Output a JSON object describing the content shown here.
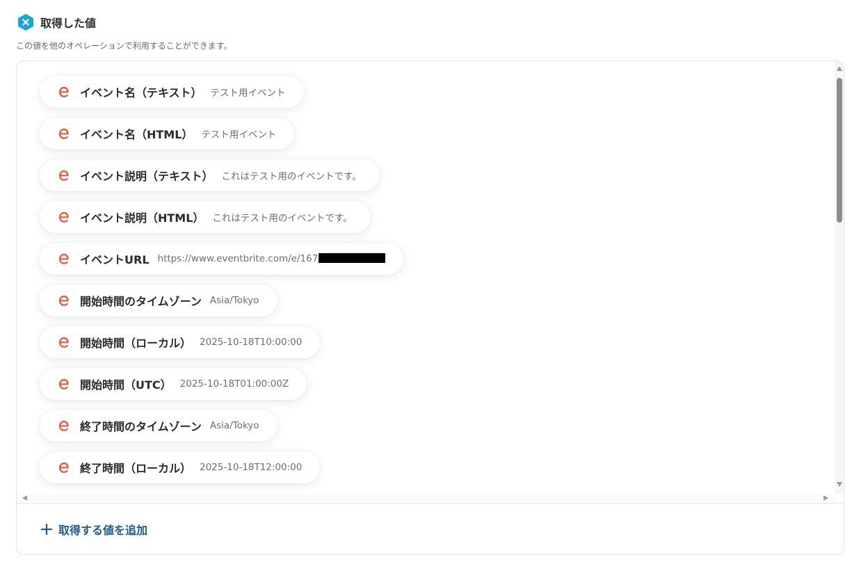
{
  "header": {
    "title": "取得した値",
    "subtitle": "この値を他のオペレーションで利用することができます。",
    "icon": "close-hex-icon"
  },
  "colors": {
    "accent": "#1aa7d8",
    "eventbrite": "#f05537",
    "link": "#1e5a8a"
  },
  "items": [
    {
      "label": "イベント名（テキスト）",
      "value": "テスト用イベント"
    },
    {
      "label": "イベント名（HTML）",
      "value": "テスト用イベント"
    },
    {
      "label": "イベント説明（テキスト）",
      "value": "これはテスト用のイベントです。"
    },
    {
      "label": "イベント説明（HTML）",
      "value": "これはテスト用のイベントです。"
    },
    {
      "label": "イベントURL",
      "value": "https://www.eventbrite.com/e/167",
      "redacted": true
    },
    {
      "label": "開始時間のタイムゾーン",
      "value": "Asia/Tokyo"
    },
    {
      "label": "開始時間（ローカル）",
      "value": "2025-10-18T10:00:00"
    },
    {
      "label": "開始時間（UTC）",
      "value": "2025-10-18T01:00:00Z"
    },
    {
      "label": "終了時間のタイムゾーン",
      "value": "Asia/Tokyo"
    },
    {
      "label": "終了時間（ローカル）",
      "value": "2025-10-18T12:00:00"
    }
  ],
  "footer": {
    "add_label": "取得する値を追加",
    "icon": "plus-icon"
  }
}
